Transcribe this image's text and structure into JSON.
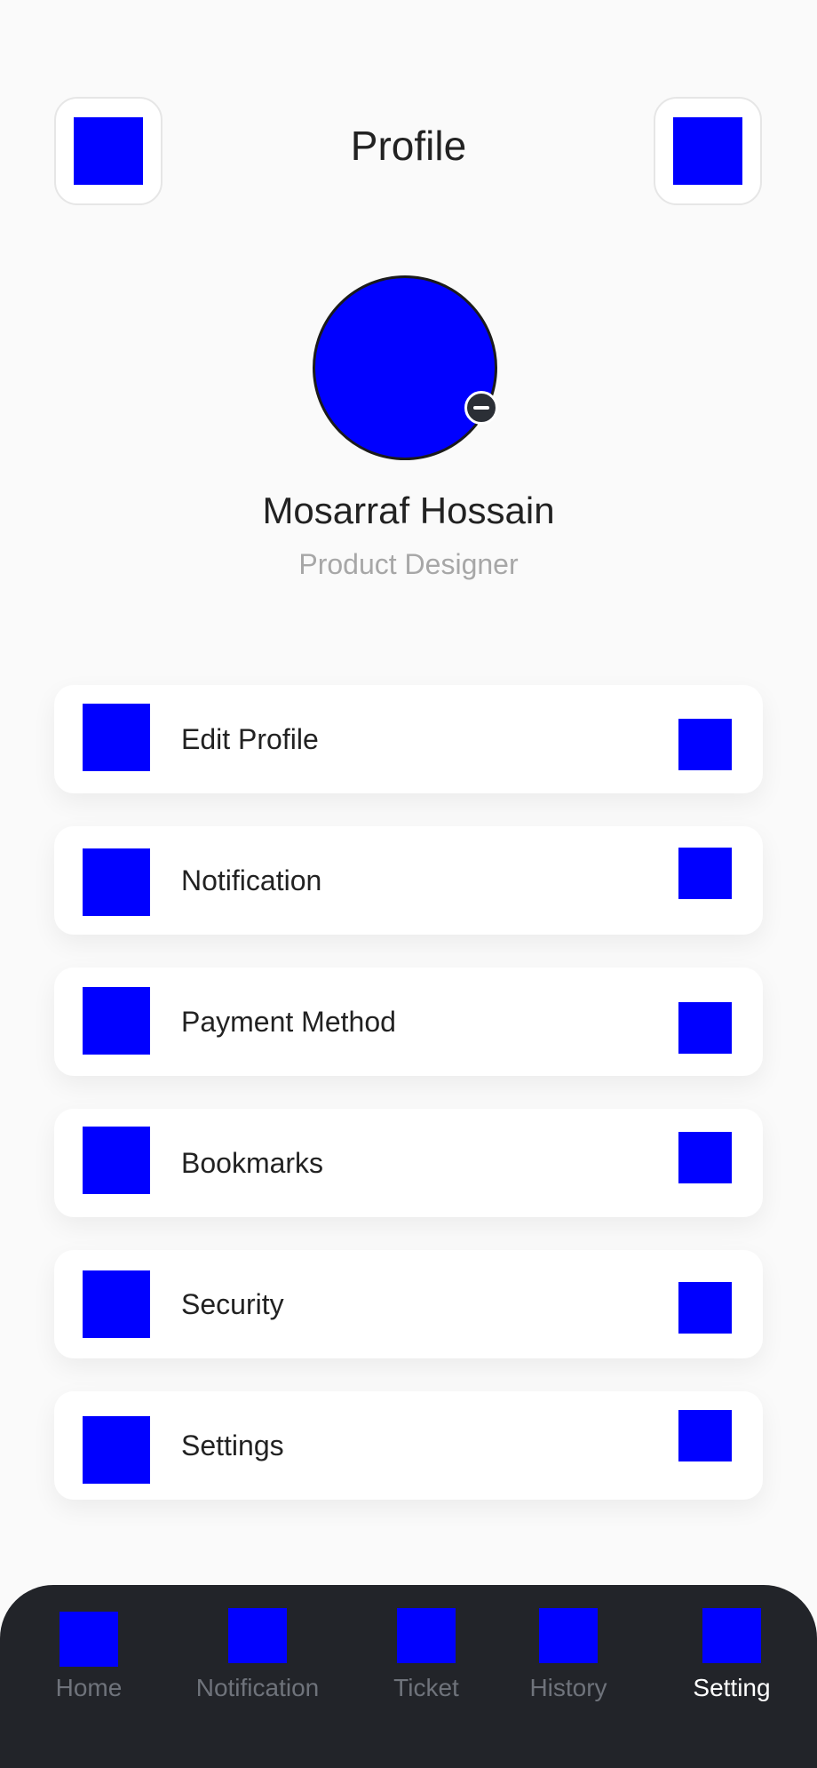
{
  "header": {
    "title": "Profile",
    "left_icon": "back-icon",
    "right_icon": "more-icon"
  },
  "profile": {
    "name": "Mosarraf Hossain",
    "role": "Product Designer",
    "avatar_color": "#0000ff",
    "edit_icon": "edit-icon"
  },
  "menu": {
    "items": [
      {
        "label": "Edit Profile",
        "icon": "user-icon"
      },
      {
        "label": "Notification",
        "icon": "bell-icon"
      },
      {
        "label": "Payment Method",
        "icon": "wallet-icon"
      },
      {
        "label": "Bookmarks",
        "icon": "bookmark-icon"
      },
      {
        "label": "Security",
        "icon": "shield-icon"
      },
      {
        "label": "Settings",
        "icon": "gear-icon"
      }
    ],
    "trail_icon": "chevron-right-icon"
  },
  "bottom_nav": {
    "items": [
      {
        "label": "Home",
        "icon": "home-icon"
      },
      {
        "label": "Notification",
        "icon": "bell-icon"
      },
      {
        "label": "Ticket",
        "icon": "ticket-icon"
      },
      {
        "label": "History",
        "icon": "history-icon"
      },
      {
        "label": "Setting",
        "icon": "gear-icon"
      }
    ],
    "active": "Setting"
  },
  "colors": {
    "placeholder": "#0000ff",
    "nav_background": "#222429",
    "nav_active": "#ffffff",
    "nav_inactive": "#6f737b"
  }
}
